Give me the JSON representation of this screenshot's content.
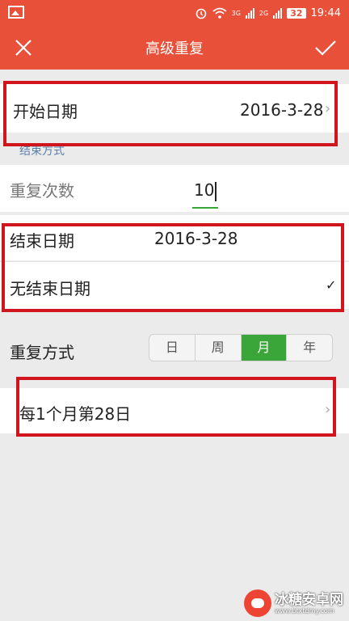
{
  "status_bar": {
    "time": "19:44",
    "battery": "32",
    "network_tag": "3G",
    "network_tag2": "2G"
  },
  "app_bar": {
    "title": "高级重复"
  },
  "start_date": {
    "label": "开始日期",
    "value": "2016-3-28"
  },
  "end_section_label": "结束方式",
  "repeat_count": {
    "label": "重复次数",
    "value": "10"
  },
  "end_date": {
    "label": "结束日期",
    "value": "2016-3-28"
  },
  "no_end_date": {
    "label": "无结束日期",
    "check": "✓"
  },
  "repeat_mode": {
    "label": "重复方式",
    "options": [
      "日",
      "周",
      "月",
      "年"
    ],
    "selected": "月"
  },
  "rule": {
    "label": "每1个月第28日"
  },
  "watermark": {
    "text": "冰糖安卓网",
    "url": "www.btxtdmy.com"
  },
  "colors": {
    "accent": "#e8503a",
    "highlight": "#d0161c",
    "active": "#3aa63a"
  }
}
